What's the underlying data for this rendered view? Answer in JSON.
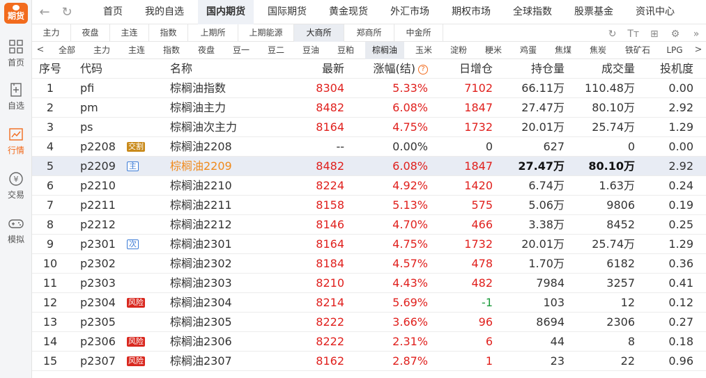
{
  "sidebar": {
    "logo_label": "期货",
    "items": [
      {
        "label": "首页",
        "icon": "grid-icon"
      },
      {
        "label": "自选",
        "icon": "bookmark-plus-icon"
      },
      {
        "label": "行情",
        "icon": "chart-icon",
        "active": true
      },
      {
        "label": "交易",
        "icon": "yen-icon"
      },
      {
        "label": "模拟",
        "icon": "gamepad-icon"
      }
    ]
  },
  "topnav": {
    "tabs": [
      "首页",
      "我的自选",
      "国内期货",
      "国际期货",
      "黄金现货",
      "外汇市场",
      "期权市场",
      "全球指数",
      "股票基金",
      "资讯中心"
    ],
    "active": "国内期货"
  },
  "exchange_tabs": {
    "items": [
      "主力",
      "夜盘",
      "主连",
      "指数",
      "上期所",
      "上期能源",
      "大商所",
      "郑商所",
      "中金所"
    ],
    "active": "大商所"
  },
  "tools": {
    "refresh": "↻",
    "font": "Tт",
    "layout": "⊞",
    "settings": "⚙",
    "more": "»"
  },
  "category_tabs": {
    "items": [
      "全部",
      "主力",
      "主连",
      "指数",
      "夜盘",
      "豆一",
      "豆二",
      "豆油",
      "豆粕",
      "棕榈油",
      "玉米",
      "淀粉",
      "粳米",
      "鸡蛋",
      "焦煤",
      "焦炭",
      "铁矿石",
      "LPG"
    ],
    "active": "棕榈油",
    "prev": "<",
    "next": ">"
  },
  "table": {
    "headers": {
      "num": "序号",
      "code": "代码",
      "name": "名称",
      "last": "最新",
      "chg": "涨幅(结)",
      "help": "?",
      "inc": "日增仓",
      "oi": "持仓量",
      "vol": "成交量",
      "spec": "投机度"
    },
    "rows": [
      {
        "num": "1",
        "code": "pfi",
        "badge": "",
        "name": "棕榈油指数",
        "last": "8304",
        "chg": "5.33%",
        "inc": "7102",
        "oi": "66.11万",
        "vol": "110.48万",
        "spec": "0.00"
      },
      {
        "num": "2",
        "code": "pm",
        "badge": "",
        "name": "棕榈油主力",
        "last": "8482",
        "chg": "6.08%",
        "inc": "1847",
        "oi": "27.47万",
        "vol": "80.10万",
        "spec": "2.92"
      },
      {
        "num": "3",
        "code": "ps",
        "badge": "",
        "name": "棕榈油次主力",
        "last": "8164",
        "chg": "4.75%",
        "inc": "1732",
        "oi": "20.01万",
        "vol": "25.74万",
        "spec": "1.29"
      },
      {
        "num": "4",
        "code": "p2208",
        "badge": "交割",
        "name": "棕榈油2208",
        "last": "--",
        "chg": "0.00%",
        "inc": "0",
        "oi": "627",
        "vol": "0",
        "spec": "0.00"
      },
      {
        "num": "5",
        "code": "p2209",
        "badge": "主",
        "name": "棕榈油2209",
        "last": "8482",
        "chg": "6.08%",
        "inc": "1847",
        "oi": "27.47万",
        "vol": "80.10万",
        "spec": "2.92"
      },
      {
        "num": "6",
        "code": "p2210",
        "badge": "",
        "name": "棕榈油2210",
        "last": "8224",
        "chg": "4.92%",
        "inc": "1420",
        "oi": "6.74万",
        "vol": "1.63万",
        "spec": "0.24"
      },
      {
        "num": "7",
        "code": "p2211",
        "badge": "",
        "name": "棕榈油2211",
        "last": "8158",
        "chg": "5.13%",
        "inc": "575",
        "oi": "5.06万",
        "vol": "9806",
        "spec": "0.19"
      },
      {
        "num": "8",
        "code": "p2212",
        "badge": "",
        "name": "棕榈油2212",
        "last": "8146",
        "chg": "4.70%",
        "inc": "466",
        "oi": "3.38万",
        "vol": "8452",
        "spec": "0.25"
      },
      {
        "num": "9",
        "code": "p2301",
        "badge": "次",
        "name": "棕榈油2301",
        "last": "8164",
        "chg": "4.75%",
        "inc": "1732",
        "oi": "20.01万",
        "vol": "25.74万",
        "spec": "1.29"
      },
      {
        "num": "10",
        "code": "p2302",
        "badge": "",
        "name": "棕榈油2302",
        "last": "8184",
        "chg": "4.57%",
        "inc": "478",
        "oi": "1.70万",
        "vol": "6182",
        "spec": "0.36"
      },
      {
        "num": "11",
        "code": "p2303",
        "badge": "",
        "name": "棕榈油2303",
        "last": "8210",
        "chg": "4.43%",
        "inc": "482",
        "oi": "7984",
        "vol": "3257",
        "spec": "0.41"
      },
      {
        "num": "12",
        "code": "p2304",
        "badge": "风险",
        "name": "棕榈油2304",
        "last": "8214",
        "chg": "5.69%",
        "inc": "-1",
        "oi": "103",
        "vol": "12",
        "spec": "0.12"
      },
      {
        "num": "13",
        "code": "p2305",
        "badge": "",
        "name": "棕榈油2305",
        "last": "8222",
        "chg": "3.66%",
        "inc": "96",
        "oi": "8694",
        "vol": "2306",
        "spec": "0.27"
      },
      {
        "num": "14",
        "code": "p2306",
        "badge": "风险",
        "name": "棕榈油2306",
        "last": "8222",
        "chg": "2.31%",
        "inc": "6",
        "oi": "44",
        "vol": "8",
        "spec": "0.18"
      },
      {
        "num": "15",
        "code": "p2307",
        "badge": "风险",
        "name": "棕榈油2307",
        "last": "8162",
        "chg": "2.87%",
        "inc": "1",
        "oi": "23",
        "vol": "22",
        "spec": "0.96"
      }
    ],
    "selected_row": "5"
  },
  "colors": {
    "accent": "#f26b1d",
    "up": "#e0201d",
    "down": "#1a9a3a",
    "selected_row_bg": "#e8ecf4"
  }
}
